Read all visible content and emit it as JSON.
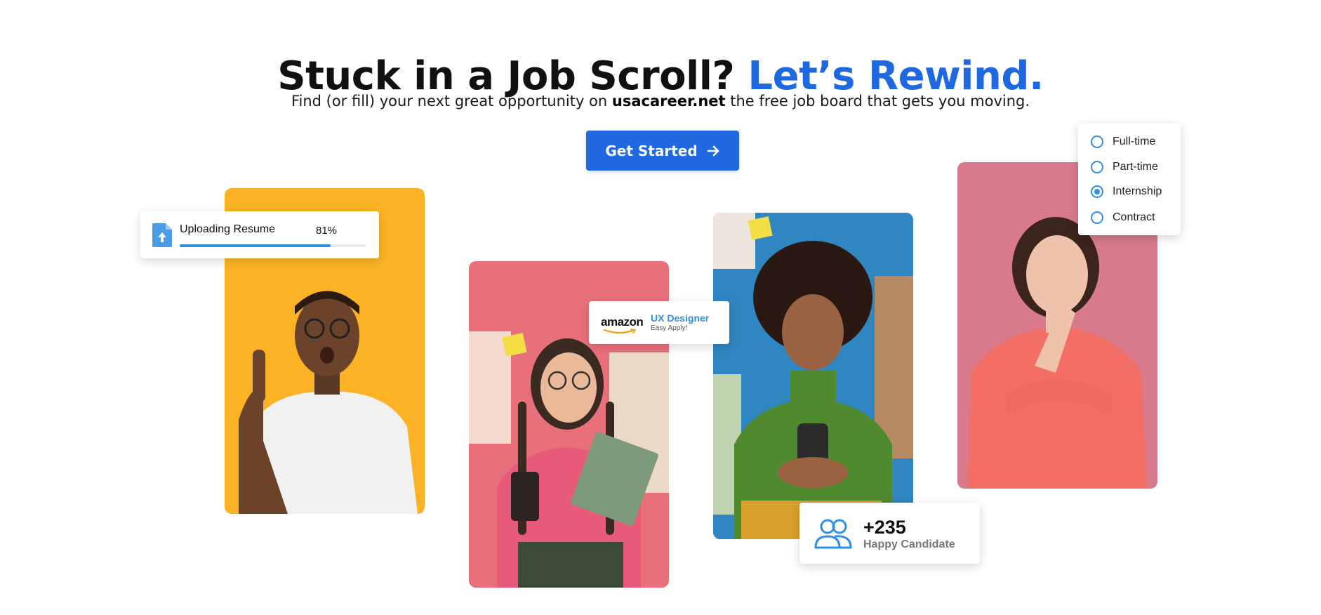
{
  "hero": {
    "title_main": "Stuck in a Job Scroll?",
    "title_accent": "Let’s Rewind.",
    "subtitle_pre": "Find (or fill) your next great opportunity on",
    "subtitle_brand": "usacareer.net",
    "subtitle_post": "the free job board that gets you moving.",
    "cta_label": "Get Started",
    "cta_icon": "arrow-right-icon"
  },
  "upload_card": {
    "label": "Uploading Resume",
    "percent_text": "81%",
    "progress": 0.81,
    "icon": "file-upload-icon"
  },
  "job_card": {
    "company": "amazon",
    "role": "UX Designer",
    "note": "Easy Apply!"
  },
  "job_type_filter": {
    "options": [
      "Full-time",
      "Part-time",
      "Internship",
      "Contract"
    ],
    "selected": "Internship"
  },
  "candidates_card": {
    "count": "+235",
    "label": "Happy Candidate",
    "icon": "people-icon"
  },
  "colors": {
    "accent": "#1f68e0",
    "light_blue": "#2f8fe8",
    "card_yellow": "#fbb325",
    "card_pink": "#e8707a",
    "card_blue": "#2f86c1",
    "card_rose": "#d87a8c"
  }
}
